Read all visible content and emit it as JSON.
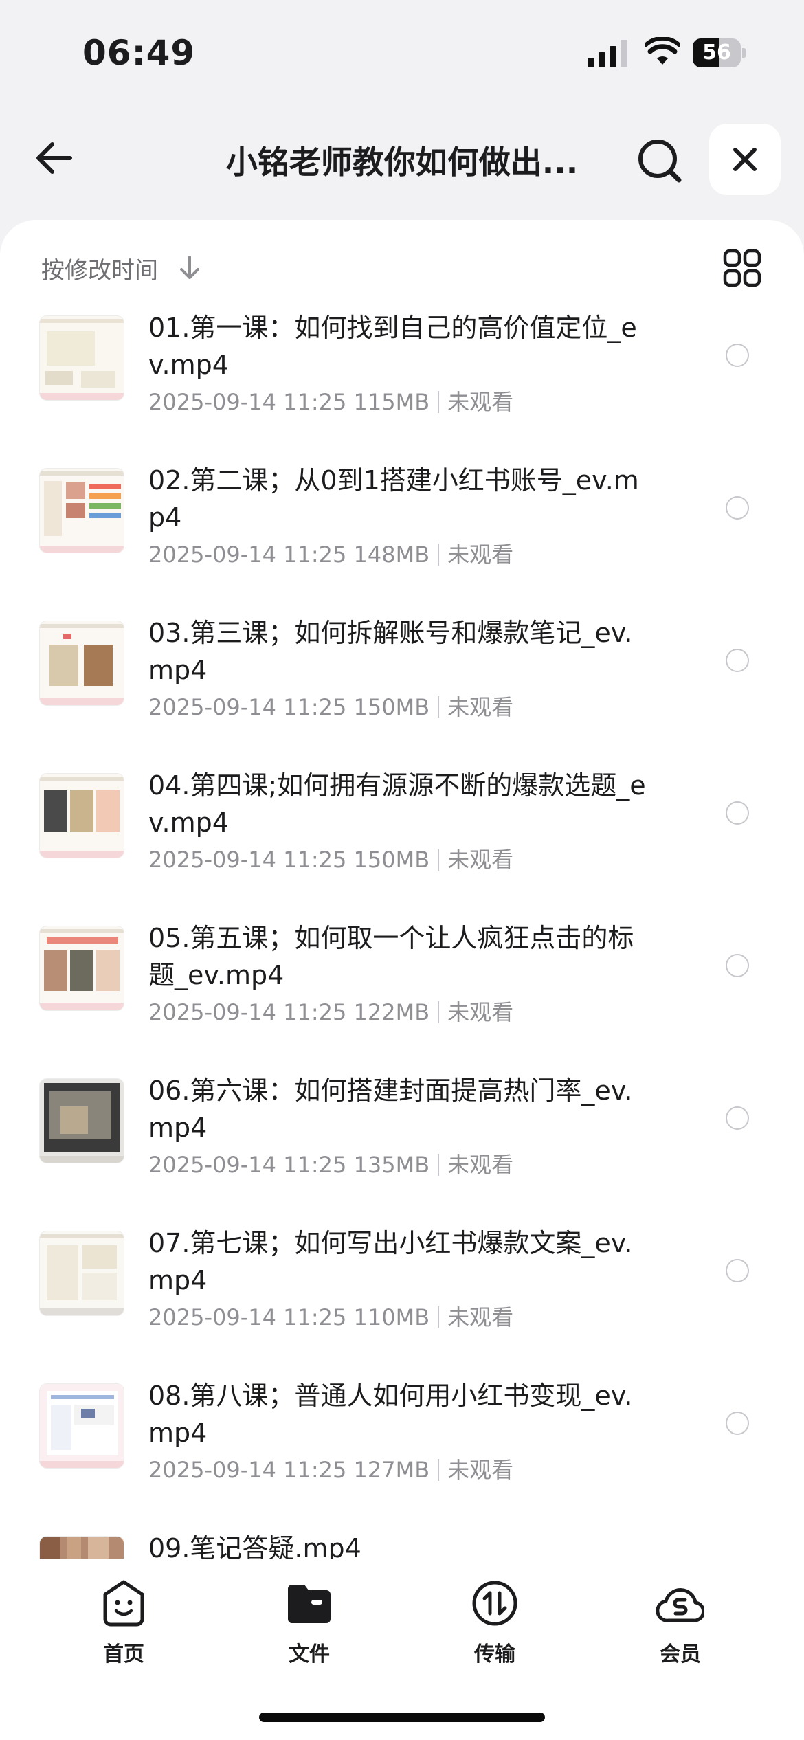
{
  "status_bar": {
    "time": "06:49",
    "battery": "56",
    "battery_level": 0.56
  },
  "header": {
    "title": "小铭老师教你如何做出..."
  },
  "sort": {
    "label": "按修改时间"
  },
  "files": [
    {
      "name": "01.第一课：如何找到自己的高价值定位_ev.mp4",
      "date": "2025-09-14 11:25",
      "size": "115MB",
      "status": "未观看"
    },
    {
      "name": "02.第二课；从0到1搭建小红书账号_ev.mp4",
      "date": "2025-09-14 11:25",
      "size": "148MB",
      "status": "未观看"
    },
    {
      "name": "03.第三课；如何拆解账号和爆款笔记_ev.mp4",
      "date": "2025-09-14 11:25",
      "size": "150MB",
      "status": "未观看"
    },
    {
      "name": "04.第四课;如何拥有源源不断的爆款选题_ev.mp4",
      "date": "2025-09-14 11:25",
      "size": "150MB",
      "status": "未观看"
    },
    {
      "name": "05.第五课；如何取一个让人疯狂点击的标题_ev.mp4",
      "date": "2025-09-14 11:25",
      "size": "122MB",
      "status": "未观看"
    },
    {
      "name": "06.第六课：如何搭建封面提高热门率_ev.mp4",
      "date": "2025-09-14 11:25",
      "size": "135MB",
      "status": "未观看"
    },
    {
      "name": "07.第七课；如何写出小红书爆款文案_ev.mp4",
      "date": "2025-09-14 11:25",
      "size": "110MB",
      "status": "未观看"
    },
    {
      "name": "08.第八课；普通人如何用小红书变现_ev.mp4",
      "date": "2025-09-14 11:25",
      "size": "127MB",
      "status": "未观看"
    },
    {
      "name": "09.笔记答疑.mp4"
    }
  ],
  "nav": {
    "home": "首页",
    "files": "文件",
    "transfer": "传输",
    "member": "会员"
  },
  "icons": {
    "back": "arrow-left-icon",
    "search": "search-icon",
    "close": "close-icon",
    "sort": "arrow-down-icon",
    "grid": "grid-view-icon",
    "home": "smiley-icon",
    "files": "folder-icon",
    "transfer": "transfer-icon",
    "member": "cloud-s-icon"
  }
}
